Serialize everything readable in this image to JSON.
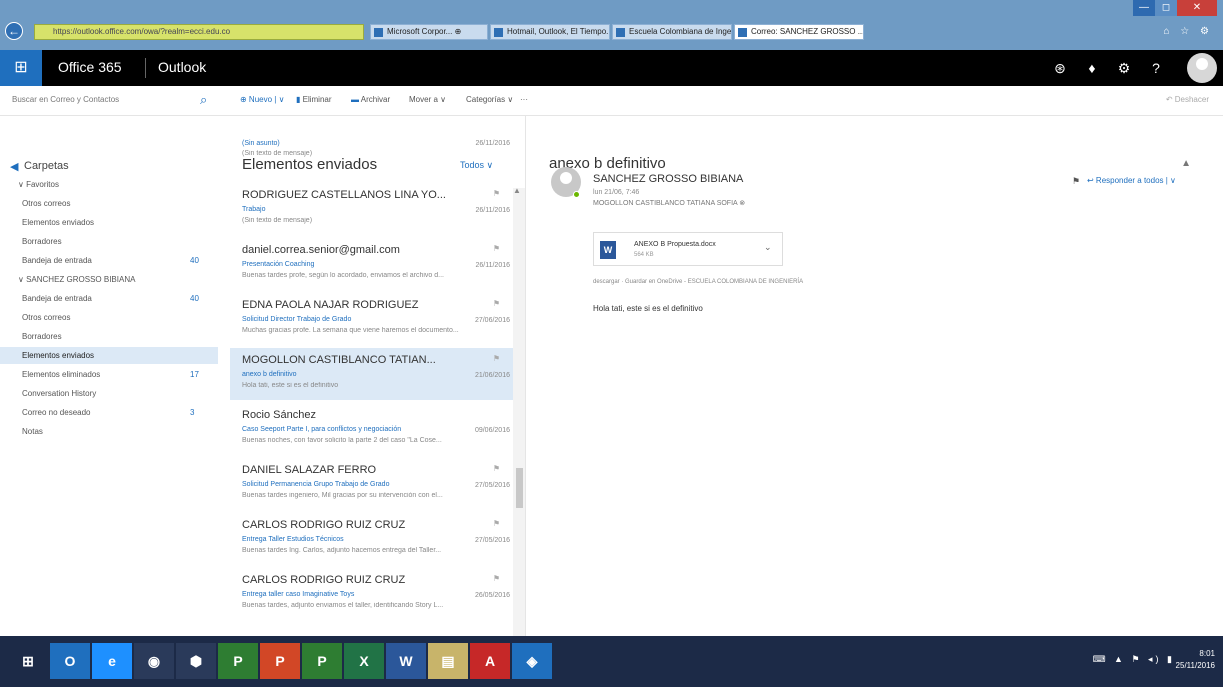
{
  "browser": {
    "url": "https://outlook.office.com/owa/?realm=ecci.edu.co",
    "tabs": [
      {
        "label": "Microsoft Corpor... ⊕"
      },
      {
        "label": "Hotmail, Outlook, El Tiempo..."
      },
      {
        "label": "Escuela Colombiana de Ingeni..."
      },
      {
        "label": "Correo: SANCHEZ GROSSO ... ×"
      }
    ],
    "controls": {
      "min": "—",
      "max": "◻",
      "close": "✕"
    }
  },
  "header": {
    "suite": "Office 365",
    "app": "Outlook",
    "icons": [
      "skype-icon",
      "bell-icon",
      "gear-icon",
      "help-icon"
    ]
  },
  "commandbar": {
    "search_placeholder": "Buscar en Correo y Contactos",
    "new": "⊕ Nuevo | ∨",
    "delete": "Eliminar",
    "archive": "Archivar",
    "move": "Mover a ∨",
    "categories": "Categorías ∨",
    "more": "···",
    "undo": "↶ Deshacer"
  },
  "leftnav": {
    "header": "Carpetas",
    "items": [
      {
        "label": "∨ Favoritos",
        "count": "",
        "indent": 0
      },
      {
        "label": "Otros correos",
        "count": "",
        "indent": 1
      },
      {
        "label": "Elementos enviados",
        "count": "",
        "indent": 1
      },
      {
        "label": "Borradores",
        "count": "",
        "indent": 1
      },
      {
        "label": "Bandeja de entrada",
        "count": "40",
        "indent": 1
      },
      {
        "label": "∨ SANCHEZ GROSSO BIBIANA",
        "count": "",
        "indent": 0
      },
      {
        "label": "Bandeja de entrada",
        "count": "40",
        "indent": 1
      },
      {
        "label": "Otros correos",
        "count": "",
        "indent": 1
      },
      {
        "label": "Borradores",
        "count": "",
        "indent": 1
      },
      {
        "label": "Elementos enviados",
        "count": "",
        "indent": 1,
        "selected": true
      },
      {
        "label": "Elementos eliminados",
        "count": "17",
        "indent": 1
      },
      {
        "label": "Conversation History",
        "count": "",
        "indent": 1
      },
      {
        "label": "Correo no deseado",
        "count": "3",
        "indent": 1
      },
      {
        "label": "Notas",
        "count": "",
        "indent": 1
      }
    ]
  },
  "list": {
    "title": "Elementos enviados",
    "filter": "Todos ∨",
    "messages": [
      {
        "sender": "",
        "subject": "(Sin asunto)",
        "preview": "(Sin texto de mensaje)",
        "date": "26/11/2016",
        "flag": "",
        "selected": false
      },
      {
        "sender": "RODRIGUEZ CASTELLANOS LINA YO...",
        "subject": "Trabajo",
        "preview": "(Sin texto de mensaje)",
        "date": "26/11/2016",
        "flag": "⚑",
        "selected": false
      },
      {
        "sender": "daniel.correa.senior@gmail.com",
        "subject": "Presentación Coaching",
        "preview": "Buenas tardes profe, según lo acordado, enviamos el archivo d...",
        "date": "26/11/2016",
        "flag": "⚑",
        "selected": false
      },
      {
        "sender": "EDNA PAOLA NAJAR RODRIGUEZ",
        "subject": "Solicitud Director Trabajo de Grado",
        "preview": "Muchas gracias profe. La semana que viene haremos el documento...",
        "date": "27/06/2016",
        "flag": "⚑",
        "selected": false
      },
      {
        "sender": "MOGOLLON CASTIBLANCO TATIAN...",
        "subject": "anexo b definitivo",
        "preview": "Hola tati, este si es el definitivo",
        "date": "21/06/2016",
        "flag": "⚑",
        "selected": true
      },
      {
        "sender": "Rocio Sánchez",
        "subject": "Caso Seeport Parte I, para conflictos y negociación",
        "preview": "Buenas noches, con favor solicito la parte 2 del caso \"La Cose...",
        "date": "09/06/2016",
        "flag": "",
        "selected": false
      },
      {
        "sender": "DANIEL SALAZAR FERRO",
        "subject": "Solicitud Permanencia Grupo Trabajo de Grado",
        "preview": "Buenas tardes ingeniero, Mil gracias por su intervención con el...",
        "date": "27/05/2016",
        "flag": "⚑",
        "selected": false
      },
      {
        "sender": "CARLOS RODRIGO RUIZ CRUZ",
        "subject": "Entrega Taller Estudios Técnicos",
        "preview": "Buenas tardes Ing. Carlos, adjunto hacemos entrega del Taller...",
        "date": "27/05/2016",
        "flag": "⚑",
        "selected": false
      },
      {
        "sender": "CARLOS RODRIGO RUIZ CRUZ",
        "subject": "Entrega taller caso Imaginative Toys",
        "preview": "Buenas tardes, adjunto enviamos el taller, identificando Story L...",
        "date": "26/05/2016",
        "flag": "⚑",
        "selected": false
      }
    ]
  },
  "reading": {
    "subject": "anexo b definitivo",
    "from": "SANCHEZ GROSSO BIBIANA",
    "date": "lun 21/06, 7:46",
    "to": "MOGOLLON CASTIBLANCO TATIANA SOFIA ⊗",
    "reply": "↩ Responder a todos | ∨",
    "attachment": {
      "name": "ANEXO B Propuesta.docx",
      "size": "564 KB",
      "icon": "W"
    },
    "attachment_actions": "descargar · Guardar en OneDrive - ESCUELA COLOMBIANA DE INGENIERÍA",
    "body": "Hola tati, este si es el definitivo"
  },
  "taskbar": {
    "apps": [
      {
        "name": "windows-start-icon",
        "glyph": "⊞",
        "color": "#1c2a47"
      },
      {
        "name": "outlook-app-icon",
        "glyph": "O",
        "color": "#1f6fbe"
      },
      {
        "name": "ie-app-icon",
        "glyph": "e",
        "color": "#1e90ff"
      },
      {
        "name": "chrome-app-icon",
        "glyph": "◉",
        "color": "#2a3a5a"
      },
      {
        "name": "network-app-icon",
        "glyph": "⬢",
        "color": "#2a3a5a"
      },
      {
        "name": "project-app-icon",
        "glyph": "P",
        "color": "#2e7d32"
      },
      {
        "name": "powerpoint-app-icon",
        "glyph": "P",
        "color": "#d24726"
      },
      {
        "name": "project2-app-icon",
        "glyph": "P",
        "color": "#2e7d32"
      },
      {
        "name": "excel-app-icon",
        "glyph": "X",
        "color": "#217346"
      },
      {
        "name": "word-app-icon",
        "glyph": "W",
        "color": "#2b579a"
      },
      {
        "name": "files-app-icon",
        "glyph": "▤",
        "color": "#c8b46a"
      },
      {
        "name": "acrobat-app-icon",
        "glyph": "A",
        "color": "#c62828"
      },
      {
        "name": "settings-app-icon",
        "glyph": "◈",
        "color": "#1f6fbe"
      }
    ],
    "tray": "⌨ ▲ ⚑ ◂) ▮",
    "time": "8:01",
    "date": "25/11/2016"
  }
}
